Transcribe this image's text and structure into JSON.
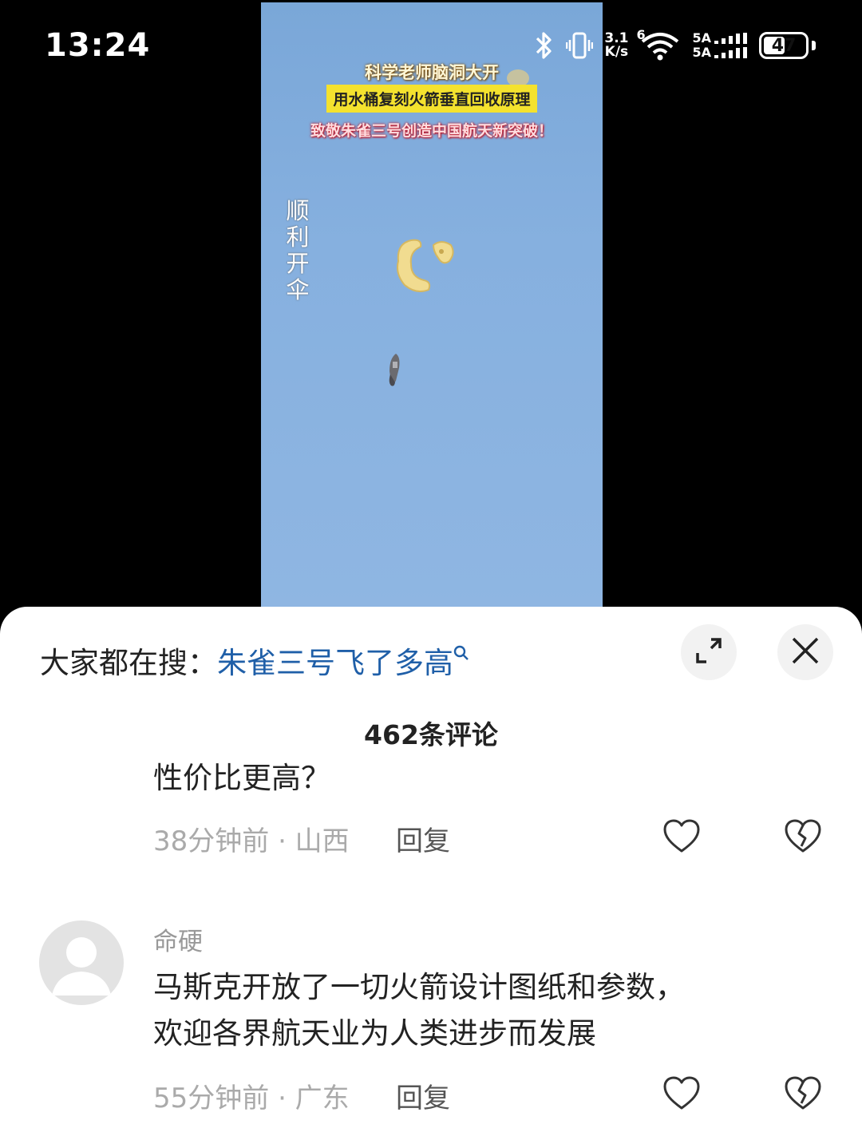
{
  "status_bar": {
    "time": "13:24",
    "net_speed_value": "3.1",
    "net_speed_unit": "K/s",
    "wifi_label": "6",
    "signal1_label": "5A",
    "signal2_label": "5A",
    "battery": "47",
    "battery_level": 0.47
  },
  "video": {
    "caption1": "科学老师脑洞大开",
    "caption2": "用水桶复刻火箭垂直回收原理",
    "caption3": "致敬朱雀三号创造中国航天新突破！",
    "vertical_text": "顺利开伞"
  },
  "panel": {
    "search_prefix": "大家都在搜：",
    "search_keyword": "朱雀三号飞了多高",
    "comment_count": "462条评论",
    "comments": [
      {
        "text": "性价比更高？",
        "meta": "38分钟前 · 山西",
        "reply": "回复"
      },
      {
        "user": "命硬",
        "text_line1": "马斯克开放了一切火箭设计图纸和参数，",
        "text_line2": "欢迎各界航天业为人类进步而发展",
        "meta": "55分钟前 · 广东",
        "reply": "回复"
      }
    ]
  },
  "icons": {
    "bluetooth": "bluetooth-icon",
    "vibrate": "vibrate-icon",
    "wifi": "wifi-icon",
    "signal": "signal-icon",
    "battery": "battery-icon",
    "search": "search-icon",
    "expand": "expand-icon",
    "close": "close-icon",
    "like": "heart-icon",
    "dislike": "broken-heart-icon",
    "avatar": "avatar-placeholder-icon"
  }
}
